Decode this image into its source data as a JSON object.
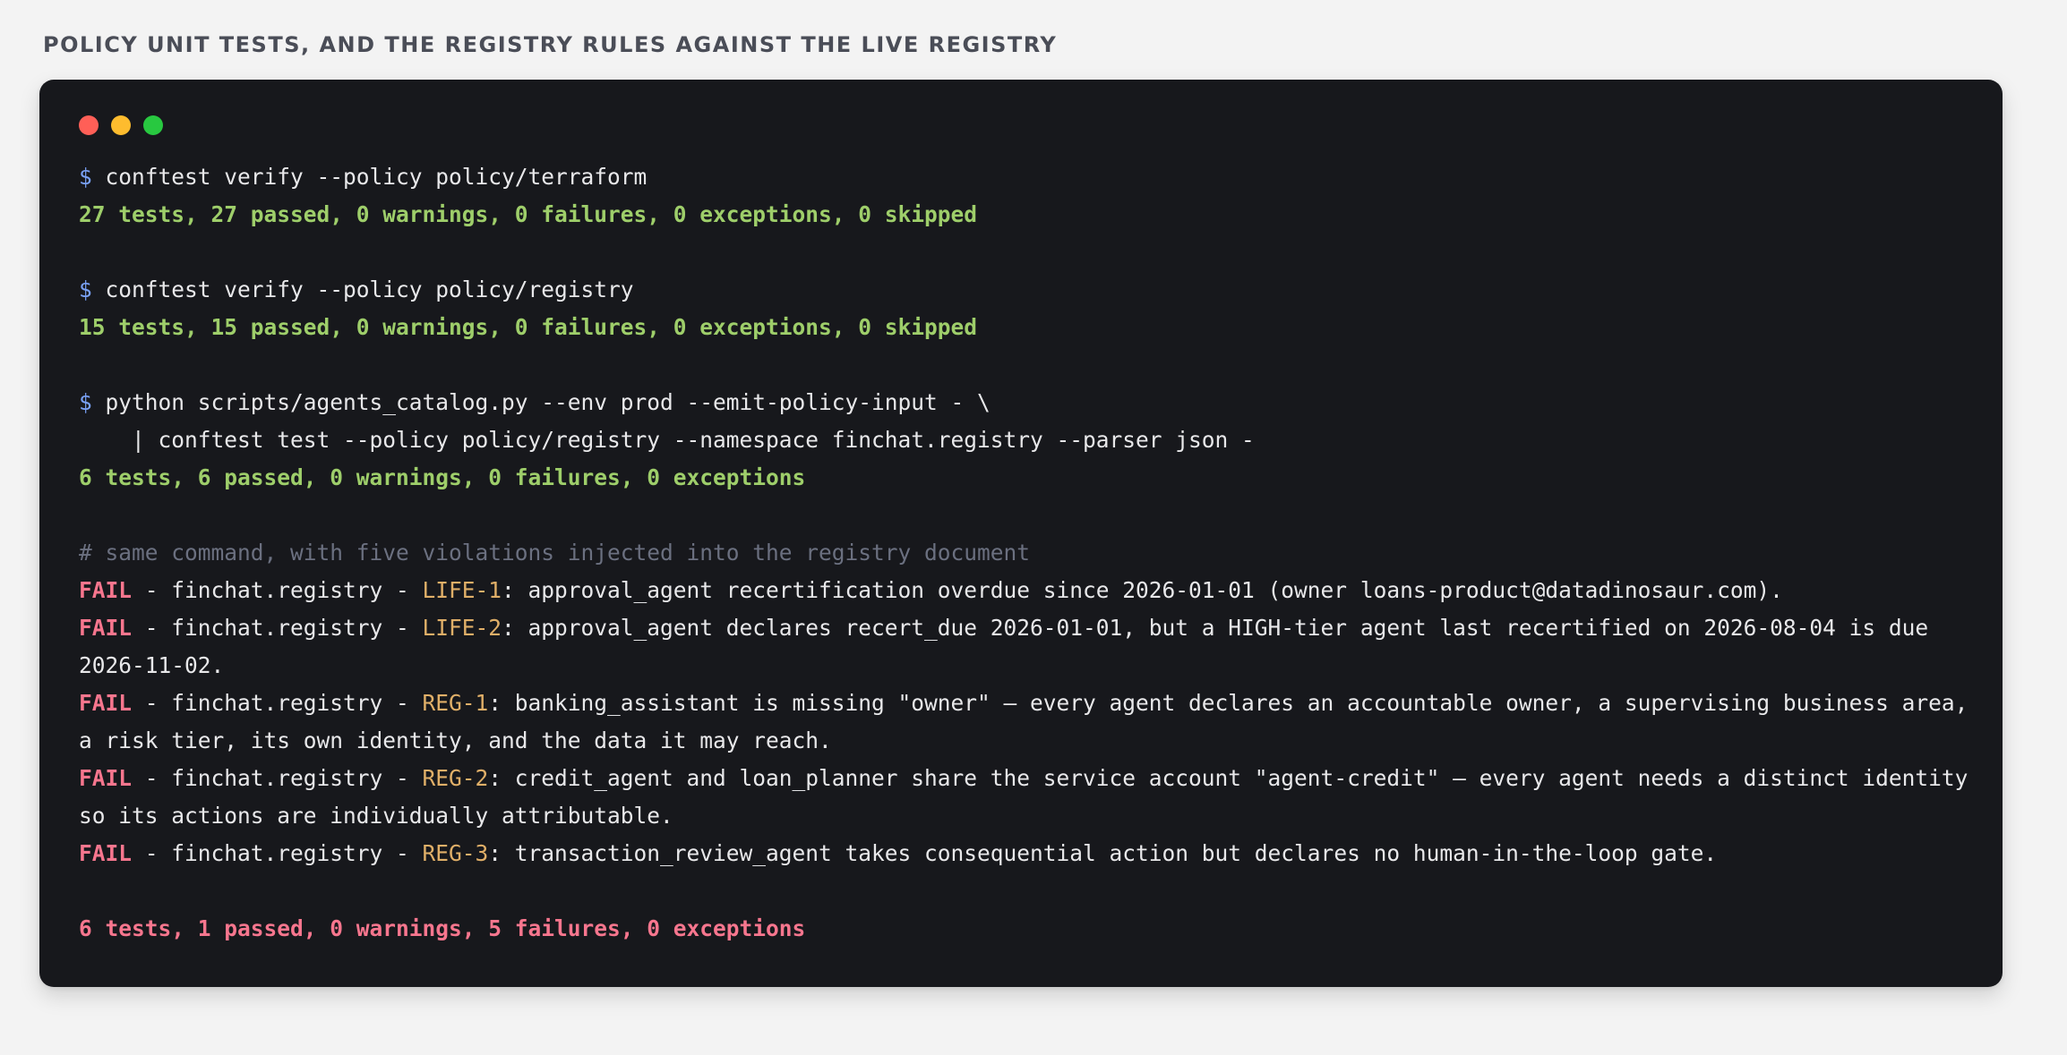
{
  "caption": "POLICY UNIT TESTS, AND THE REGISTRY RULES AGAINST THE LIVE REGISTRY",
  "terminal": {
    "prompt_symbol": "$",
    "block1": {
      "command": "conftest verify --policy policy/terraform",
      "result": "27 tests, 27 passed, 0 warnings, 0 failures, 0 exceptions, 0 skipped"
    },
    "block2": {
      "command": "conftest verify --policy policy/registry",
      "result": "15 tests, 15 passed, 0 warnings, 0 failures, 0 exceptions, 0 skipped"
    },
    "block3": {
      "command_line1": "python scripts/agents_catalog.py --env prod --emit-policy-input - \\",
      "command_line2": "    | conftest test --policy policy/registry --namespace finchat.registry --parser json -",
      "result": "6 tests, 6 passed, 0 warnings, 0 failures, 0 exceptions"
    },
    "comment": "# same command, with five violations injected into the registry document",
    "failures": [
      {
        "tag": "FAIL",
        "namespace_sep": " - finchat.registry - ",
        "rule": "LIFE-1",
        "message": ": approval_agent recertification overdue since 2026-01-01 (owner loans-product@datadinosaur.com)."
      },
      {
        "tag": "FAIL",
        "namespace_sep": " - finchat.registry - ",
        "rule": "LIFE-2",
        "message": ": approval_agent declares recert_due 2026-01-01, but a HIGH-tier agent last recertified on 2026-08-04 is due 2026-11-02."
      },
      {
        "tag": "FAIL",
        "namespace_sep": " - finchat.registry - ",
        "rule": "REG-1",
        "message": ": banking_assistant is missing \"owner\" — every agent declares an accountable owner, a supervising business area, a risk tier, its own identity, and the data it may reach."
      },
      {
        "tag": "FAIL",
        "namespace_sep": " - finchat.registry - ",
        "rule": "REG-2",
        "message": ": credit_agent and loan_planner share the service account \"agent-credit\" — every agent needs a distinct identity so its actions are individually attributable."
      },
      {
        "tag": "FAIL",
        "namespace_sep": " - finchat.registry - ",
        "rule": "REG-3",
        "message": ": transaction_review_agent takes consequential action but declares no human-in-the-loop gate."
      }
    ],
    "final_result": "6 tests, 1 passed, 0 warnings, 5 failures, 0 exceptions"
  },
  "colors": {
    "page_bg": "#f3f3f3",
    "terminal_bg": "#17181c",
    "prompt": "#7aa2f7",
    "success": "#9ece6a",
    "fail": "#f7768e",
    "rule_id": "#e0af68",
    "comment": "#6b7080",
    "text": "#e8e8ea"
  }
}
